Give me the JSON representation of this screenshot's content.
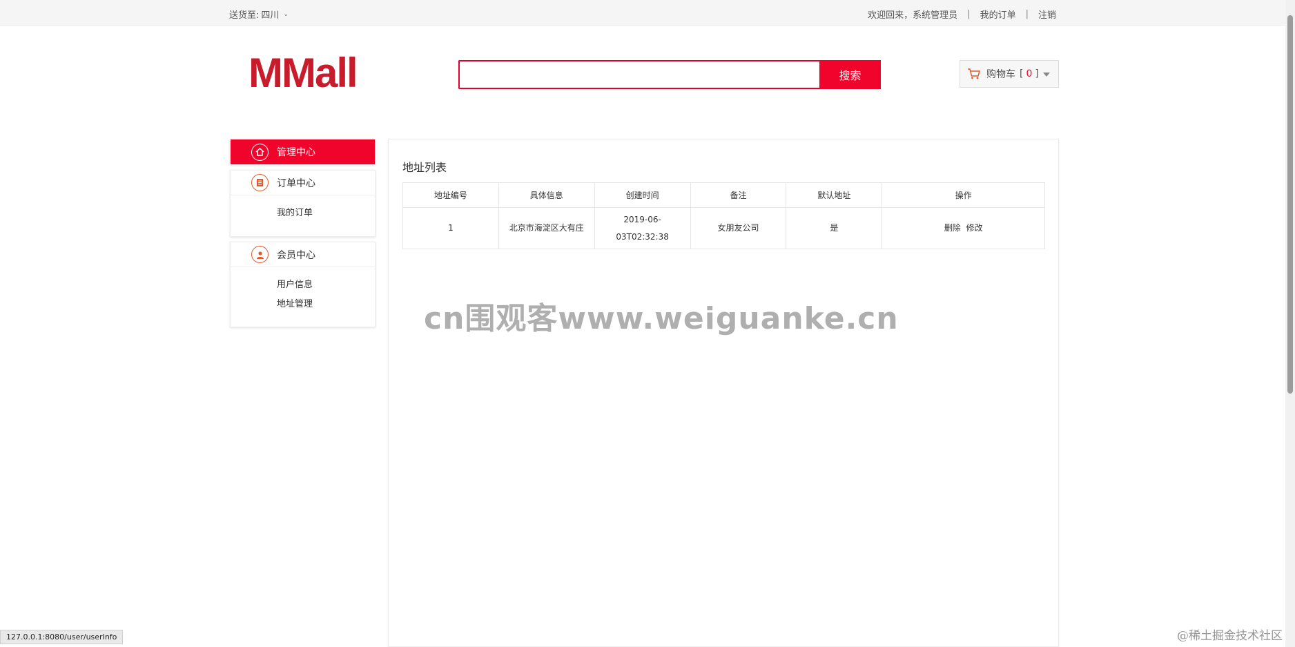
{
  "topbar": {
    "deliver_label": "送货至:",
    "deliver_value": "四川",
    "welcome": "欢迎回来，系统管理员",
    "separator": "|",
    "my_orders": "我的订单",
    "logout": "注销"
  },
  "header": {
    "logo": "MMall",
    "search_placeholder": "",
    "search_button": "搜索",
    "cart_label": "购物车",
    "cart_count_open": "[",
    "cart_count": "0",
    "cart_count_close": "]"
  },
  "sidebar": {
    "manage_center": "管理中心",
    "order_center": "订单中心",
    "order_items": [
      "我的订单"
    ],
    "member_center": "会员中心",
    "member_items": [
      "用户信息",
      "地址管理"
    ]
  },
  "main": {
    "title": "地址列表",
    "columns": [
      "地址编号",
      "具体信息",
      "创建时间",
      "备注",
      "默认地址",
      "操作"
    ],
    "rows": [
      {
        "id": "1",
        "detail": "北京市海淀区大有庄",
        "created_line1": "2019-06-",
        "created_line2": "03T02:32:38",
        "remark": "女朋友公司",
        "is_default": "是",
        "delete": "删除",
        "edit": "修改"
      }
    ]
  },
  "watermark": "cn围观客www.weiguanke.cn",
  "statusbar": "127.0.0.1:8080/user/userInfo",
  "credit": "@稀土掘金技术社区",
  "colors": {
    "brand_red": "#f1042b",
    "logo_red": "#c81c2c",
    "icon_orange": "#e25a2a"
  }
}
